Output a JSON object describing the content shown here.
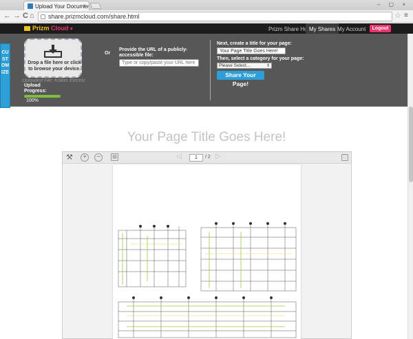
{
  "browser": {
    "tab_title": "Upload Your Documents a",
    "tab_close": "×",
    "url": "share.prizmcloud.com/share.html",
    "nav": {
      "back": "←",
      "forward": "→",
      "reload": "C",
      "home": "⌂",
      "star": "☆",
      "menu": "≡"
    },
    "window_controls": "– ▢ ×"
  },
  "appbar": {
    "logo_prizm": "Prizm",
    "logo_cloud": "Cloud",
    "logo_caret": "▾",
    "nav": [
      {
        "label": "Prizm Share Home"
      },
      {
        "label": "My Shares"
      },
      {
        "label": "My Account"
      }
    ],
    "logout": "Logout"
  },
  "customize": "CUSTOMIZE",
  "upload": {
    "dropzone_text": "Drop a file here or click to browse your device.",
    "uploaded_file": "Uploaded File: Kolker Electric",
    "upload_label": "Upload Progress:",
    "progress_value": 100,
    "progress_text": "100%",
    "or": "Or",
    "url_label": "Provide the URL of a publicly-accessible file:",
    "url_placeholder": "Type or copy/paste your URL here"
  },
  "share": {
    "title_label": "Next, create a title for your page:",
    "title_value": "Your Page Title Goes Here!",
    "category_label": "Then, select a category for your page:",
    "category_value": "Please Select...",
    "share_button": "Share Your Page!"
  },
  "page_title": "Your Page Title Goes Here!",
  "viewer": {
    "tool_icons": {
      "tools": "⚒",
      "zoom_in": "+",
      "zoom_out": "−",
      "print": "▤",
      "prev": "◁",
      "next": "▷",
      "fullscreen": "⛶"
    },
    "page_number": "1",
    "page_total": "/ 2"
  }
}
